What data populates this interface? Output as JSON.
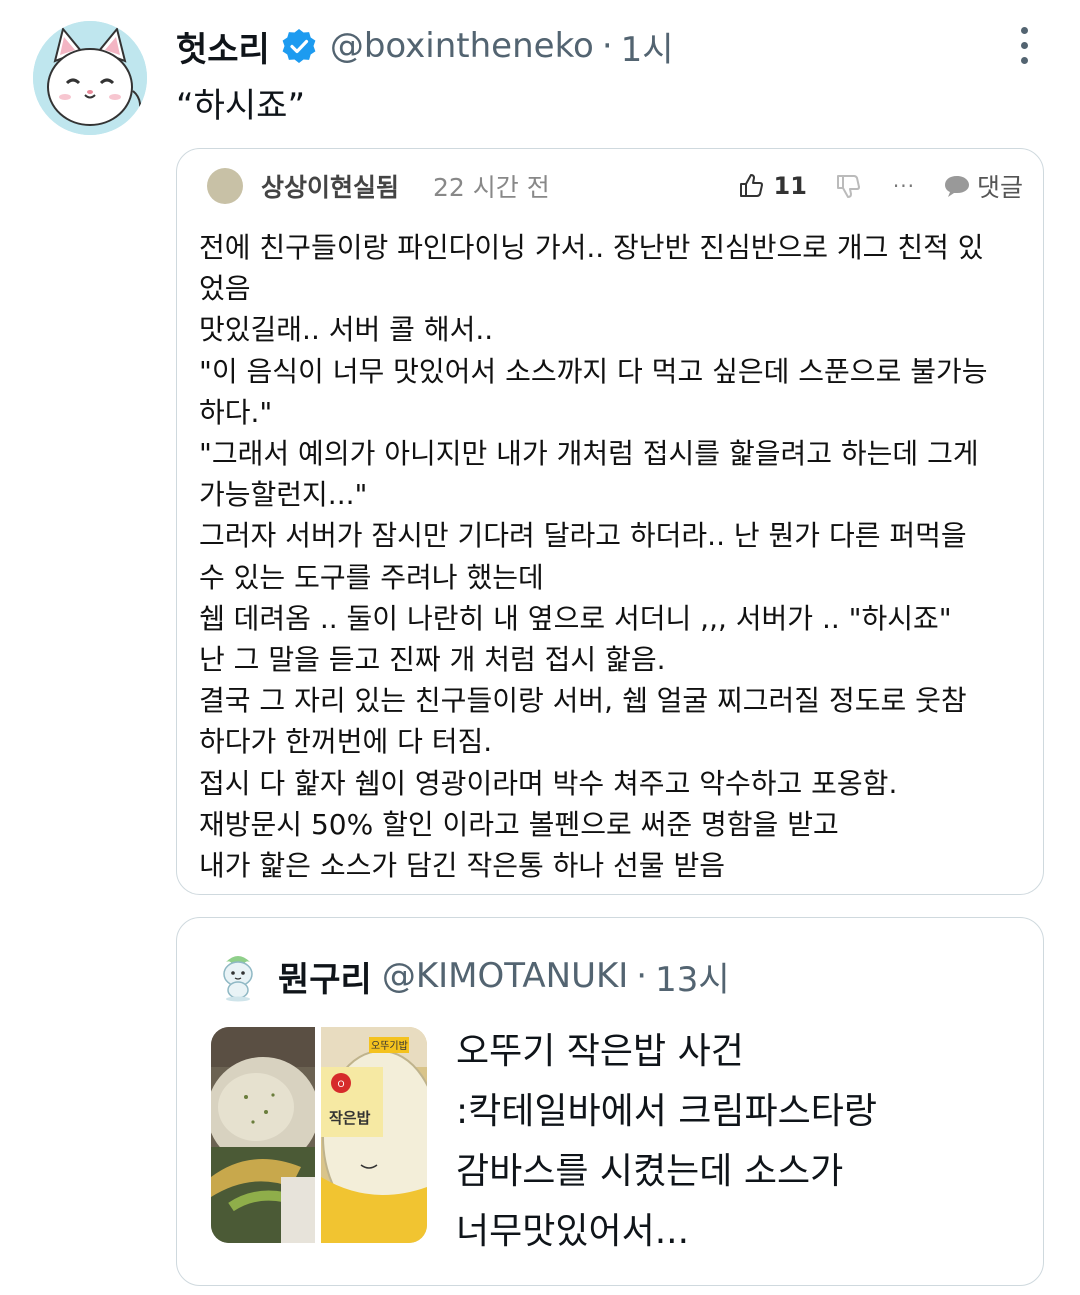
{
  "tweet": {
    "author_name": "헛소리",
    "author_handle": "@boxintheneko",
    "separator": "·",
    "time": "1시",
    "text": "“하시죠”",
    "verified_color": "#1d9bf0"
  },
  "screenshot_comment": {
    "username": "상상이현실됨",
    "time": "22 시간 전",
    "likes": "11",
    "more": "···",
    "comment_label": "댓글",
    "lines": [
      "전에 친구들이랑 파인다이닝 가서.. 장난반 진심반으로 개그 친적 있",
      "었음",
      "맛있길래.. 서버 콜 해서..",
      "\"이 음식이 너무 맛있어서 소스까지 다 먹고 싶은데 스푼으로 불가능",
      "하다.\"",
      "\"그래서 예의가 아니지만 내가 개처럼 접시를 핥을려고 하는데 그게",
      "가능할런지...\"",
      "그러자 서버가 잠시만 기다려 달라고 하더라.. 난 뭔가 다른 퍼먹을",
      "수 있는 도구를 주려나 했는데",
      "쉡 데려옴 .. 둘이 나란히 내 옆으로 서더니 ,,, 서버가 .. \"하시죠\"",
      "난 그 말을 듣고 진짜 개 처럼 접시 핥음.",
      "결국 그 자리 있는 친구들이랑 서버, 쉡 얼굴 찌그러질 정도로 웃참",
      "하다가 한꺼번에 다 터짐.",
      "접시 다 핥자 쉡이 영광이라며 박수 쳐주고 악수하고 포옹함.",
      "재방문시 50% 할인 이라고 볼펜으로 써준 명함을 받고",
      "내가 핥은 소스가 담긴 작은통 하나 선물 받음"
    ]
  },
  "quoted_tweet": {
    "author_name": "뭔구리",
    "author_handle": "@KIMOTANUKI",
    "separator": "·",
    "time": "13시",
    "lines": [
      "오뚜기 작은밥 사건",
      ":칵테일바에서 크림파스타랑",
      "감바스를 시켰는데 소스가",
      "너무맛있어서..."
    ],
    "image2_label": "작은밥",
    "image2_brand": "오뚜기밥"
  },
  "icons": {
    "avatar": "white-cat-avatar",
    "verified": "verified-badge-icon",
    "more": "more-options-icon",
    "like": "thumbs-up-icon",
    "dislike": "thumbs-down-icon",
    "comment": "comment-bubble-icon",
    "quoted_avatar": "green-mascot-avatar"
  }
}
